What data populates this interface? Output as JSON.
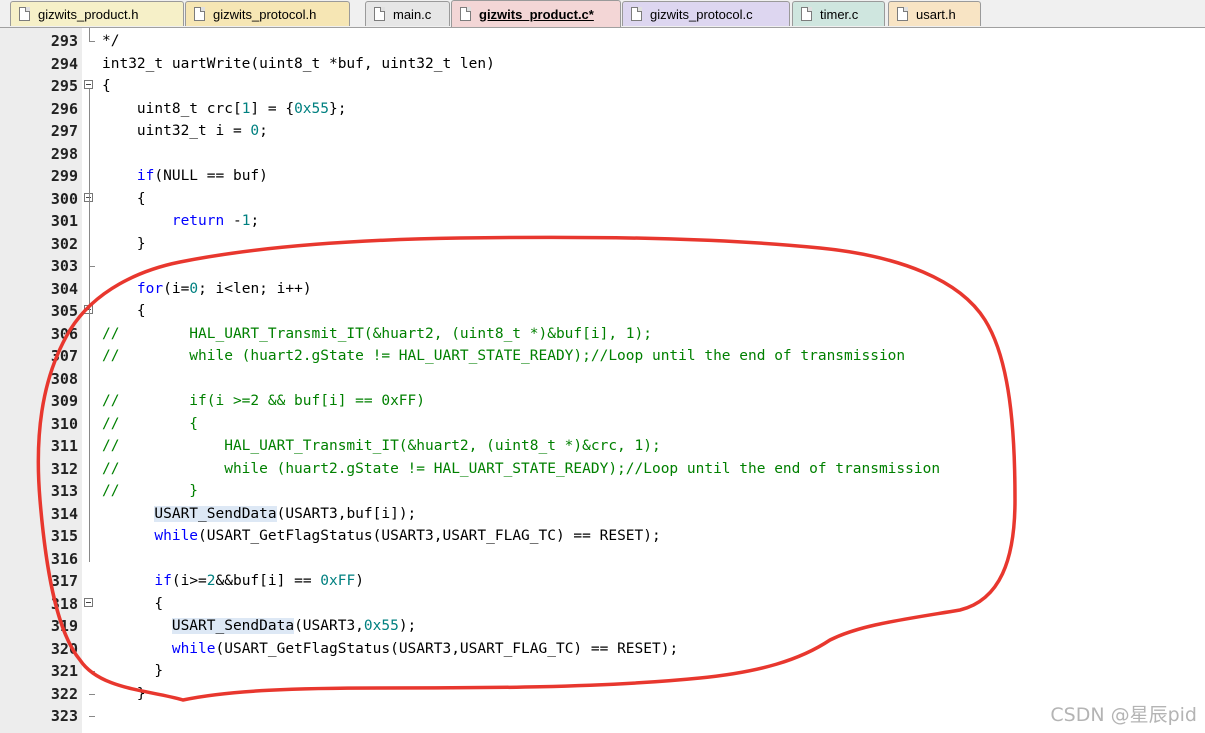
{
  "tabs": [
    {
      "label": "gizwits_product.h",
      "color": "#f6f0c8",
      "active": false
    },
    {
      "label": "gizwits_protocol.h",
      "color": "#f6e6b4",
      "active": false
    },
    {
      "label": "main.c",
      "color": "#e6e6e6",
      "active": false
    },
    {
      "label": "gizwits_product.c*",
      "color": "#f3d6d6",
      "active": true
    },
    {
      "label": "gizwits_protocol.c",
      "color": "#ddd6f0",
      "active": false
    },
    {
      "label": "timer.c",
      "color": "#cfe6df",
      "active": false
    },
    {
      "label": "usart.h",
      "color": "#f8e4c4",
      "active": false
    }
  ],
  "lines": [
    {
      "n": "293",
      "t": "*/"
    },
    {
      "n": "294",
      "t": "int32_t uartWrite(uint8_t *buf, uint32_t len)"
    },
    {
      "n": "295",
      "t": "{"
    },
    {
      "n": "296",
      "t": "    uint8_t crc[1] = {0x55};"
    },
    {
      "n": "297",
      "t": "    uint32_t i = 0;"
    },
    {
      "n": "298",
      "t": ""
    },
    {
      "n": "299",
      "t": "    if(NULL == buf)"
    },
    {
      "n": "300",
      "t": "    {"
    },
    {
      "n": "301",
      "t": "        return -1;"
    },
    {
      "n": "302",
      "t": "    }"
    },
    {
      "n": "303",
      "t": ""
    },
    {
      "n": "304",
      "t": "    for(i=0; i<len; i++)"
    },
    {
      "n": "305",
      "t": "    {"
    },
    {
      "n": "306",
      "t": "//        HAL_UART_Transmit_IT(&huart2, (uint8_t *)&buf[i], 1);"
    },
    {
      "n": "307",
      "t": "//        while (huart2.gState != HAL_UART_STATE_READY);//Loop until the end of transmission"
    },
    {
      "n": "308",
      "t": ""
    },
    {
      "n": "309",
      "t": "//        if(i >=2 && buf[i] == 0xFF)"
    },
    {
      "n": "310",
      "t": "//        {"
    },
    {
      "n": "311",
      "t": "//            HAL_UART_Transmit_IT(&huart2, (uint8_t *)&crc, 1);"
    },
    {
      "n": "312",
      "t": "//            while (huart2.gState != HAL_UART_STATE_READY);//Loop until the end of transmission"
    },
    {
      "n": "313",
      "t": "//        }"
    },
    {
      "n": "314",
      "t": "      USART_SendData(USART3,buf[i]);"
    },
    {
      "n": "315",
      "t": "      while(USART_GetFlagStatus(USART3,USART_FLAG_TC) == RESET);"
    },
    {
      "n": "316",
      "t": ""
    },
    {
      "n": "317",
      "t": "      if(i>=2&&buf[i] == 0xFF)"
    },
    {
      "n": "318",
      "t": "      {"
    },
    {
      "n": "319",
      "t": "        USART_SendData(USART3,0x55);"
    },
    {
      "n": "320",
      "t": "        while(USART_GetFlagStatus(USART3,USART_FLAG_TC) == RESET);"
    },
    {
      "n": "321",
      "t": "      }"
    },
    {
      "n": "322",
      "t": "    }"
    },
    {
      "n": "323",
      "t": ""
    }
  ],
  "watermark": "CSDN @星辰pid",
  "annotation_color": "#e8372e"
}
